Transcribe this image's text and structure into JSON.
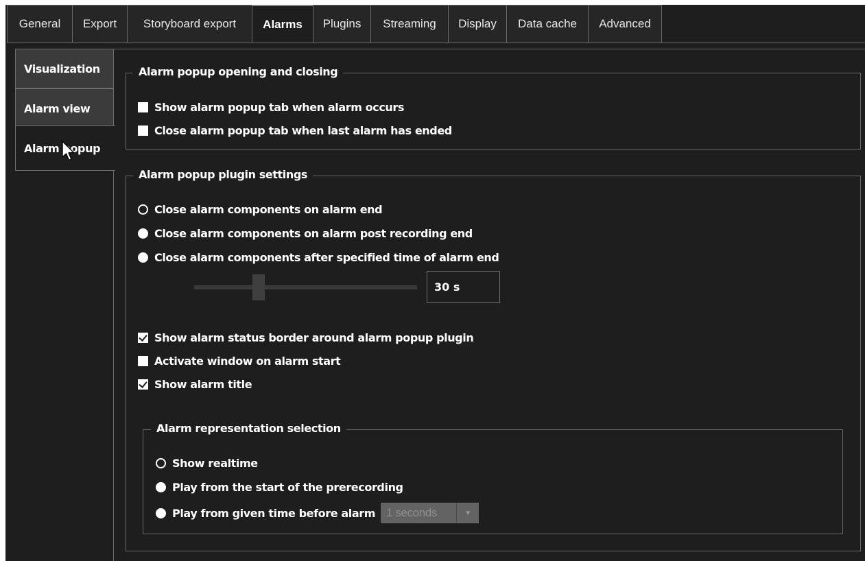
{
  "top_tabs": [
    "General",
    "Export",
    "Storyboard export",
    "Alarms",
    "Plugins",
    "Streaming",
    "Display",
    "Data cache",
    "Advanced"
  ],
  "active_top_tab": "Alarms",
  "side_tabs": [
    "Visualization",
    "Alarm view",
    "Alarm popup"
  ],
  "active_side_tab": "Alarm popup",
  "opening_group": {
    "title": "Alarm popup opening and closing",
    "show_tab": {
      "label": "Show alarm popup tab when alarm occurs",
      "checked": false
    },
    "close_tab": {
      "label": "Close alarm popup tab when last alarm has ended",
      "checked": false
    }
  },
  "plugin_group": {
    "title": "Alarm popup plugin settings",
    "close_on_end": {
      "label": "Close alarm components on alarm end",
      "selected": true
    },
    "close_on_post": {
      "label": "Close alarm components on alarm post recording end",
      "selected": false
    },
    "close_after": {
      "label": "Close alarm components after specified time of alarm end",
      "selected": false
    },
    "close_after_value": "30 s",
    "slider_fraction": 0.29,
    "status_border": {
      "label": "Show alarm status border around alarm popup plugin",
      "checked": true
    },
    "activate_window": {
      "label": "Activate window on alarm start",
      "checked": false
    },
    "show_title": {
      "label": "Show alarm title",
      "checked": true
    }
  },
  "representation_group": {
    "title": "Alarm representation selection",
    "realtime": {
      "label": "Show realtime",
      "selected": true
    },
    "prerecording": {
      "label": "Play from the start of the prerecording",
      "selected": false
    },
    "given_time": {
      "label": "Play from given time before alarm",
      "selected": false
    },
    "given_time_value": "1 seconds"
  },
  "colors": {
    "background": "#1e1e1e",
    "border": "#6a6a6a",
    "text": "#ffffff",
    "active_side_tab": "#1e1e1e",
    "inactive_side_tab": "#3b3b3b"
  }
}
